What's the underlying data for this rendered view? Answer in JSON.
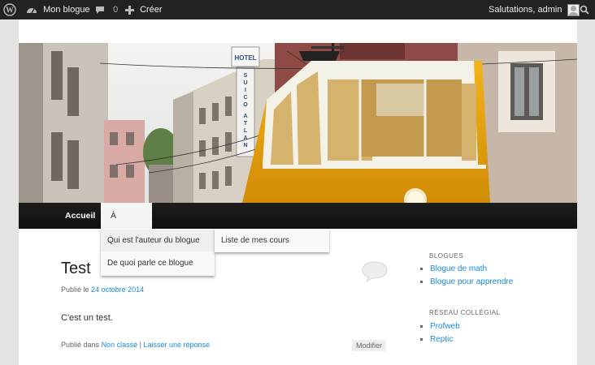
{
  "adminbar": {
    "site_name": "Mon blogue",
    "comments_count": "0",
    "new_label": "Créer",
    "greeting": "Salutations, admin"
  },
  "nav": {
    "items": [
      "Accueil",
      "À propos"
    ]
  },
  "submenu": {
    "items": [
      "Qui est l'auteur du blogue",
      "De quoi parle ce blogue"
    ],
    "child_items": [
      "Liste de mes cours"
    ]
  },
  "post": {
    "title": "Test",
    "published_prefix": "Publié le",
    "date": "24 octobre 2014",
    "content": "C'est un test.",
    "categories_prefix": "Publié dans",
    "category": "Non classé",
    "separator": "|",
    "reply_link": "Laisser une réponse",
    "edit_label": "Modifier"
  },
  "sidebar": {
    "widgets": [
      {
        "title": "BLOGUES",
        "links": [
          "Blogue de math",
          "Blogue pour apprendre"
        ]
      },
      {
        "title": "RÉSEAU COLLÉGIAL",
        "links": [
          "Profweb",
          "Reptic"
        ]
      }
    ]
  },
  "icons": {
    "wordpress": "wordpress-logo-icon",
    "dashboard": "dashboard-icon",
    "comment": "comment-bubble-icon",
    "add": "plus-icon",
    "avatar": "avatar",
    "search": "search-icon"
  }
}
